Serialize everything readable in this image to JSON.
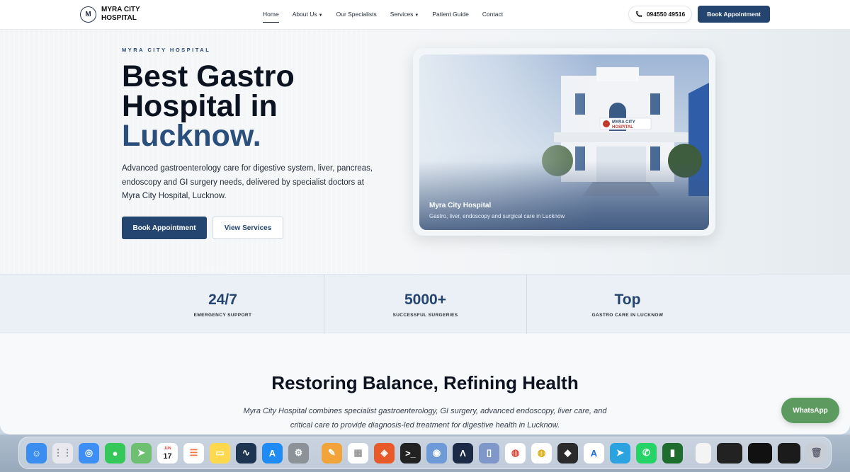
{
  "brand": {
    "mark": "M",
    "name": "MYRA CITY HOSPITAL"
  },
  "nav": {
    "items": [
      {
        "label": "Home",
        "active": true
      },
      {
        "label": "About Us",
        "dropdown": true
      },
      {
        "label": "Our Specialists"
      },
      {
        "label": "Services",
        "dropdown": true
      },
      {
        "label": "Patient Guide"
      },
      {
        "label": "Contact"
      }
    ],
    "phone": "094550 49516",
    "cta": "Book Appointment"
  },
  "hero": {
    "eyebrow": "MYRA CITY HOSPITAL",
    "title_line1": "Best Gastro",
    "title_line2": "Hospital in",
    "title_accent": "Lucknow.",
    "lead": "Advanced gastroenterology care for digestive system, liver, pancreas, endoscopy and GI surgery needs, delivered by specialist doctors at Myra City Hospital, Lucknow.",
    "primary_button": "Book Appointment",
    "secondary_button": "View Services",
    "image_caption_title": "Myra City Hospital",
    "image_caption_sub": "Gastro, liver, endoscopy and surgical care in Lucknow",
    "sign_text": "MYRA CITY HOSPITAL"
  },
  "stats": [
    {
      "value": "24/7",
      "label": "EMERGENCY SUPPORT"
    },
    {
      "value": "5000+",
      "label": "SUCCESSFUL SURGERIES"
    },
    {
      "value": "Top",
      "label": "GASTRO CARE IN LUCKNOW"
    }
  ],
  "section": {
    "heading": "Restoring Balance, Refining Health",
    "intro": "Myra City Hospital combines specialist gastroenterology, GI surgery, advanced endoscopy, liver care, and critical care to provide diagnosis-led treatment for digestive health in Lucknow."
  },
  "whatsapp": "WhatsApp",
  "colors": {
    "primary": "#24456f",
    "whatsapp": "#5c9a5f"
  },
  "dock": {
    "icons": [
      "finder-icon",
      "launchpad-icon",
      "safari-icon",
      "messages-icon",
      "maps-icon",
      "calendar-icon",
      "reminders-icon",
      "notes-icon",
      "freeform-icon",
      "app-store-icon",
      "system-settings-icon",
      "pages-icon",
      "numbers-icon",
      "brave-icon",
      "terminal-icon",
      "preview-icon",
      "arc-icon",
      "simulator-icon",
      "chrome-icon",
      "chrome-canary-icon",
      "cube-icon",
      "translate-icon",
      "telegram-icon",
      "whatsapp-icon",
      "activity-monitor-icon"
    ],
    "calendar_day": "17",
    "calendar_month": "JUN"
  }
}
